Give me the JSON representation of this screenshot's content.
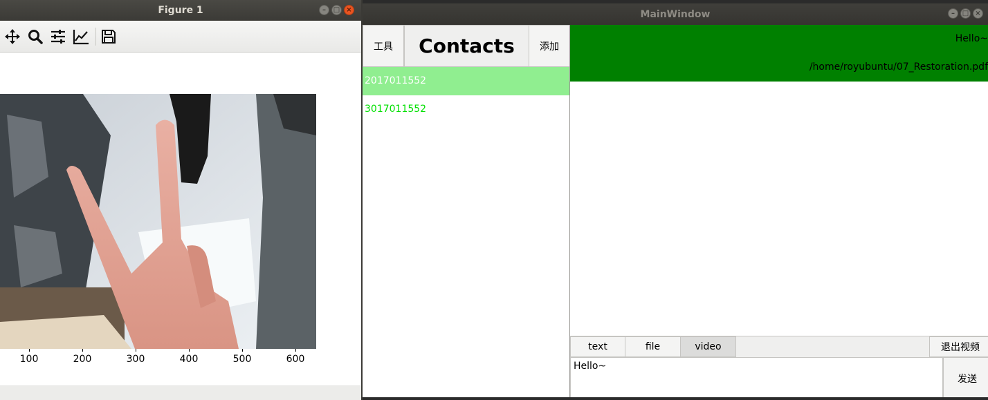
{
  "figure_window": {
    "title": "Figure 1",
    "toolbar_icons": [
      "move-icon",
      "zoom-icon",
      "configure-subplots-icon",
      "edit-axes-icon",
      "save-icon"
    ],
    "x_ticks": [
      "100",
      "200",
      "300",
      "400",
      "500",
      "600"
    ]
  },
  "main_window": {
    "title": "MainWindow",
    "tools_button": "工具",
    "contacts_title": "Contacts",
    "add_button": "添加",
    "contacts": [
      {
        "id": "2017011552",
        "selected": true
      },
      {
        "id": "3017011552",
        "selected": false
      }
    ],
    "header": {
      "message": "Hello~",
      "path": "/home/royubuntu/07_Restoration.pdf"
    },
    "tabs": [
      {
        "label": "text",
        "active": false
      },
      {
        "label": "file",
        "active": false
      },
      {
        "label": "video",
        "active": true
      }
    ],
    "exit_video_button": "退出视频",
    "input_value": "Hello~",
    "send_button": "发送"
  },
  "colors": {
    "header_bg": "#008000",
    "contact_selected_bg": "#90ee90",
    "contact_text": "#00e000",
    "close_button": "#e95420"
  }
}
